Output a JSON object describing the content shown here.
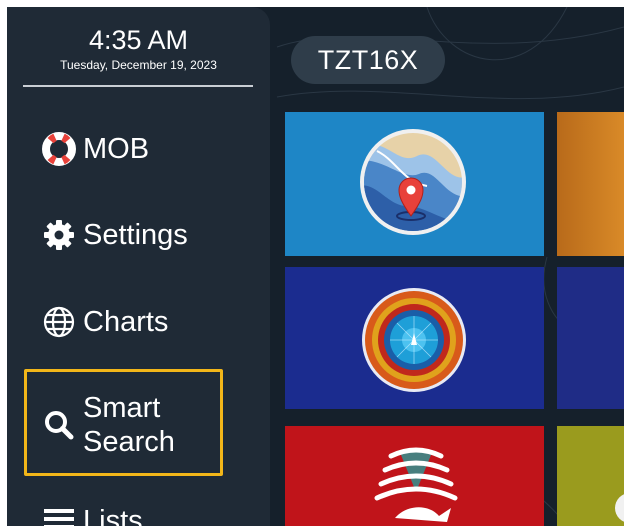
{
  "clock": {
    "time": "4:35 AM",
    "date": "Tuesday, December 19, 2023"
  },
  "device": {
    "name": "TZT16X"
  },
  "sidebar": {
    "items": [
      {
        "label": "MOB",
        "icon": "lifebuoy-icon"
      },
      {
        "label": "Settings",
        "icon": "gear-icon"
      },
      {
        "label": "Charts",
        "icon": "globe-icon"
      },
      {
        "label_line1": "Smart",
        "label_line2": "Search",
        "icon": "search-icon",
        "highlighted": true
      },
      {
        "label": "Lists",
        "icon": "list-icon"
      }
    ]
  },
  "tiles": [
    {
      "icon": "chart-plotter-icon",
      "color": "#1e86c6"
    },
    {
      "icon": "radar-icon",
      "color": "#1b2c8f"
    },
    {
      "icon": "sonar-fish-icon",
      "color": "#c0141a"
    }
  ],
  "colors": {
    "highlight": "#f2b619",
    "sidebar": "#1f2a36",
    "background": "#15202b"
  }
}
